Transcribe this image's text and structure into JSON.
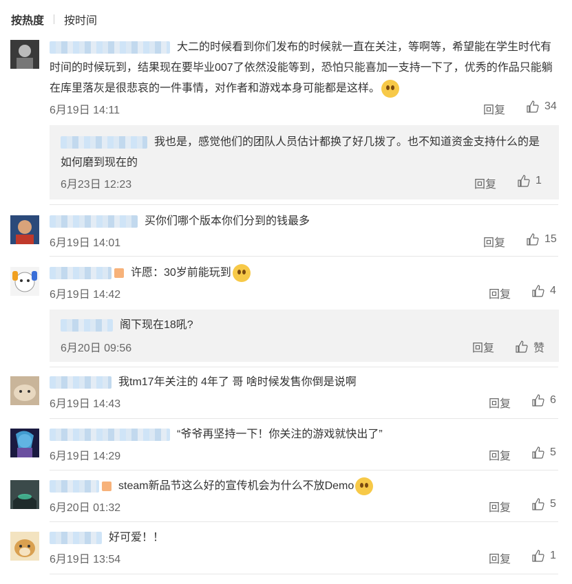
{
  "sort": {
    "hot": "按热度",
    "time": "按时间"
  },
  "reply_label": "回复",
  "comments": [
    {
      "text": "大二的时候看到你们发布的时候就一直在关注，等啊等，希望能在学生时代有时间的时候玩到，结果现在要毕业007了依然没能等到，恐怕只能喜加一支持一下了，优秀的作品只能躺在库里落灰是很悲哀的一件事情，对作者和游戏本身可能都是这样。",
      "time": "6月19日 14:11",
      "likes": "34"
    },
    {
      "text": "我也是，感觉他们的团队人员估计都换了好几拨了。也不知道资金支持什么的是如何磨到现在的",
      "time": "6月23日 12:23",
      "likes": "1"
    },
    {
      "text": "买你们哪个版本你们分到的钱最多",
      "time": "6月19日 14:01",
      "likes": "15"
    },
    {
      "text": "许愿：30岁前能玩到",
      "time": "6月19日 14:42",
      "likes": "4"
    },
    {
      "text": "阁下现在18吼?",
      "time": "6月20日 09:56",
      "likes": "赞"
    },
    {
      "text": "我tm17年关注的 4年了 哥 啥时候发售你倒是说啊",
      "time": "6月19日 14:43",
      "likes": "6"
    },
    {
      "text": "“爷爷再坚持一下！你关注的游戏就快出了”",
      "time": "6月19日 14:29",
      "likes": "5"
    },
    {
      "text": "steam新品节这么好的宣传机会为什么不放Demo",
      "time": "6月20日 01:32",
      "likes": "5"
    },
    {
      "text": "好可爱！！",
      "time": "6月19日 13:54",
      "likes": "1"
    }
  ]
}
